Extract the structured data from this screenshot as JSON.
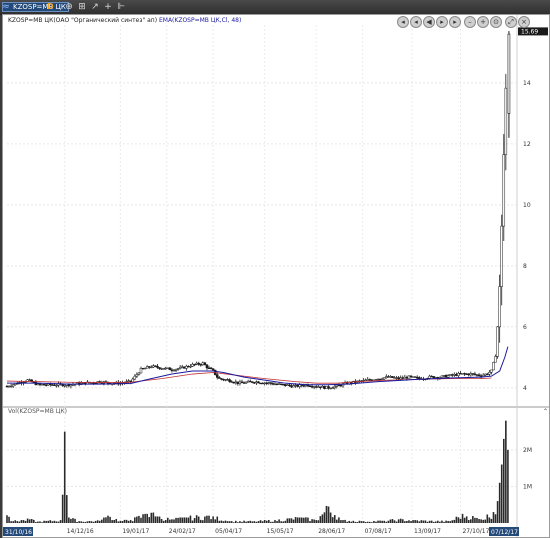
{
  "toolbar": {
    "ticker": "KZOSP=MB ЦК",
    "d_label": "D"
  },
  "price_panel": {
    "legend_main": "KZOSP=MB ЦК(ОАО \"Органический синтез\" ап)",
    "legend_ema": "EMA(KZOSP=MB ЦК,Cl, 48)",
    "last_price": "15.69",
    "y_ticks": [
      "14",
      "12",
      "10",
      "8",
      "6",
      "4"
    ]
  },
  "volume_panel": {
    "legend": "Vol(KZOSP=MB ЦК)",
    "y_ticks": [
      "2M",
      "1M"
    ]
  },
  "x_axis": {
    "start_label": "31/10/16",
    "end_label": "07/12/17",
    "ticks": [
      "14/12/16",
      "19/01/17",
      "24/02/17",
      "05/04/17",
      "15/05/17",
      "28/06/17",
      "07/08/17",
      "13/09/17",
      "27/10/17"
    ]
  },
  "colors": {
    "ema": "#1a1aa0",
    "reference": "#c03030",
    "candle": "#1a1a1a",
    "toolbar_bg": "#3a3a3a"
  },
  "chart_data": {
    "type": "candlestick",
    "series": [
      {
        "name": "KZOSP=MB ЦК",
        "type": "ohlc"
      },
      {
        "name": "EMA(KZOSP=MB ЦК,Cl, 48)",
        "type": "line"
      }
    ],
    "ylim": [
      3.5,
      15.9
    ],
    "last_value": 15.69,
    "close_profile": [
      [
        0,
        4.05
      ],
      [
        10,
        4.15
      ],
      [
        20,
        4.25
      ],
      [
        30,
        4.1
      ],
      [
        40,
        4.1
      ],
      [
        60,
        4.1
      ],
      [
        75,
        4.15
      ],
      [
        90,
        4.2
      ],
      [
        100,
        4.15
      ],
      [
        110,
        4.15
      ],
      [
        120,
        4.2
      ],
      [
        130,
        4.6
      ],
      [
        140,
        4.7
      ],
      [
        150,
        4.65
      ],
      [
        160,
        4.6
      ],
      [
        170,
        4.65
      ],
      [
        180,
        4.75
      ],
      [
        190,
        4.8
      ],
      [
        195,
        4.65
      ],
      [
        200,
        4.55
      ],
      [
        205,
        4.3
      ],
      [
        215,
        4.25
      ],
      [
        225,
        4.15
      ],
      [
        240,
        4.2
      ],
      [
        255,
        4.15
      ],
      [
        265,
        4.1
      ],
      [
        280,
        4.05
      ],
      [
        290,
        4.1
      ],
      [
        300,
        4.05
      ],
      [
        310,
        4.0
      ],
      [
        320,
        4.05
      ],
      [
        330,
        4.15
      ],
      [
        340,
        4.2
      ],
      [
        350,
        4.25
      ],
      [
        360,
        4.3
      ],
      [
        370,
        4.35
      ],
      [
        380,
        4.3
      ],
      [
        390,
        4.35
      ],
      [
        400,
        4.3
      ],
      [
        410,
        4.35
      ],
      [
        420,
        4.35
      ],
      [
        430,
        4.4
      ],
      [
        440,
        4.45
      ],
      [
        450,
        4.45
      ],
      [
        460,
        4.4
      ],
      [
        465,
        4.45
      ],
      [
        470,
        4.55
      ],
      [
        472,
        4.8
      ],
      [
        475,
        5.2
      ],
      [
        477,
        6.8
      ],
      [
        479,
        7.8
      ],
      [
        481,
        10.8
      ],
      [
        483,
        12.5
      ],
      [
        485,
        15.2
      ]
    ],
    "ema_profile": [
      [
        0,
        4.15
      ],
      [
        30,
        4.15
      ],
      [
        60,
        4.12
      ],
      [
        90,
        4.12
      ],
      [
        120,
        4.14
      ],
      [
        140,
        4.3
      ],
      [
        160,
        4.45
      ],
      [
        180,
        4.55
      ],
      [
        200,
        4.55
      ],
      [
        210,
        4.5
      ],
      [
        230,
        4.35
      ],
      [
        250,
        4.25
      ],
      [
        270,
        4.15
      ],
      [
        290,
        4.1
      ],
      [
        310,
        4.1
      ],
      [
        330,
        4.12
      ],
      [
        360,
        4.2
      ],
      [
        400,
        4.28
      ],
      [
        430,
        4.32
      ],
      [
        460,
        4.35
      ],
      [
        470,
        4.38
      ],
      [
        478,
        4.55
      ],
      [
        483,
        5.0
      ],
      [
        486,
        5.35
      ]
    ],
    "reference_line_profile": [
      [
        0,
        4.22
      ],
      [
        30,
        4.2
      ],
      [
        60,
        4.18
      ],
      [
        90,
        4.17
      ],
      [
        120,
        4.18
      ],
      [
        150,
        4.3
      ],
      [
        180,
        4.45
      ],
      [
        200,
        4.5
      ],
      [
        220,
        4.42
      ],
      [
        250,
        4.3
      ],
      [
        280,
        4.2
      ],
      [
        300,
        4.15
      ],
      [
        320,
        4.15
      ],
      [
        340,
        4.2
      ],
      [
        370,
        4.25
      ],
      [
        400,
        4.28
      ],
      [
        430,
        4.3
      ],
      [
        460,
        4.3
      ],
      [
        470,
        4.32
      ]
    ],
    "volume_profile": [
      [
        5,
        0.05
      ],
      [
        15,
        0.08
      ],
      [
        22,
        0.1
      ],
      [
        30,
        0.04
      ],
      [
        40,
        0.06
      ],
      [
        52,
        0.08
      ],
      [
        56,
        2.5
      ],
      [
        60,
        0.15
      ],
      [
        70,
        0.05
      ],
      [
        90,
        0.06
      ],
      [
        98,
        0.2
      ],
      [
        110,
        0.06
      ],
      [
        120,
        0.08
      ],
      [
        135,
        0.25
      ],
      [
        140,
        0.28
      ],
      [
        145,
        0.18
      ],
      [
        160,
        0.1
      ],
      [
        175,
        0.15
      ],
      [
        195,
        0.2
      ],
      [
        200,
        0.18
      ],
      [
        215,
        0.05
      ],
      [
        240,
        0.05
      ],
      [
        260,
        0.08
      ],
      [
        285,
        0.15
      ],
      [
        300,
        0.08
      ],
      [
        312,
        0.45
      ],
      [
        325,
        0.08
      ],
      [
        345,
        0.05
      ],
      [
        365,
        0.06
      ],
      [
        380,
        0.1
      ],
      [
        395,
        0.08
      ],
      [
        410,
        0.06
      ],
      [
        430,
        0.05
      ],
      [
        442,
        0.25
      ],
      [
        460,
        0.1
      ],
      [
        472,
        0.3
      ],
      [
        476,
        0.6
      ],
      [
        478,
        1.1
      ],
      [
        480,
        1.6
      ],
      [
        482,
        2.3
      ],
      [
        484,
        2.8
      ],
      [
        486,
        2.0
      ],
      [
        488,
        0.4
      ]
    ],
    "volume_ylim": [
      0,
      2.9
    ]
  }
}
